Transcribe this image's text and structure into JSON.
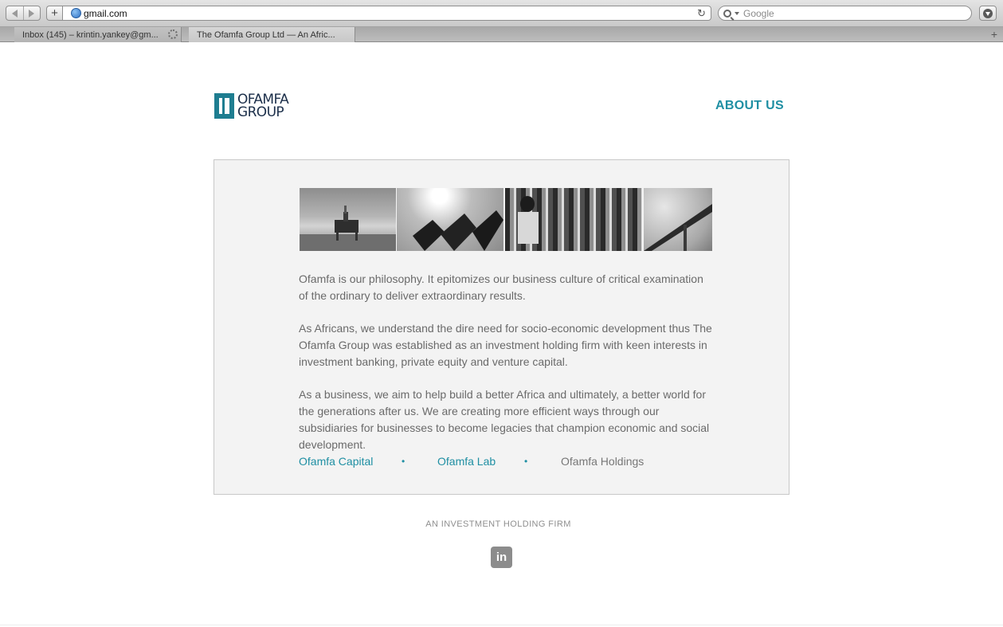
{
  "browser": {
    "url": "gmail.com",
    "search_placeholder": "Google",
    "add_label": "+",
    "reload_glyph": "↻",
    "tabs": [
      {
        "label": "Inbox (145) – krintin.yankey@gm..."
      },
      {
        "label": "The Ofamfa Group Ltd — An Afric..."
      }
    ],
    "new_tab_glyph": "+"
  },
  "header": {
    "logo_line1": "OFAMFA",
    "logo_line2": "GROUP",
    "nav_about": "ABOUT US"
  },
  "main": {
    "photos": [
      "oil-rig-photo",
      "solar-panels-photo",
      "market-vendor-photo",
      "highway-bridge-photo"
    ],
    "paragraphs": [
      "Ofamfa is our philosophy. It epitomizes our business culture of critical examination of the ordinary to deliver extraordinary results.",
      "As Africans, we understand the dire need for socio-economic development thus The Ofamfa Group was established as an investment holding firm with keen interests in investment banking, private equity and venture capital.",
      "As a business, we aim to help build a better Africa and ultimately, a better world for the generations after us. We are creating more efficient ways through our subsidiaries for businesses to become legacies that champion economic and social development."
    ],
    "subsidiaries": [
      "Ofamfa Capital",
      "Ofamfa Lab",
      "Ofamfa Holdings"
    ],
    "separator": "•"
  },
  "footer": {
    "tagline": "AN INVESTMENT HOLDING FIRM",
    "linkedin_label": "in"
  },
  "colors": {
    "accent": "#1f8fa3",
    "logo_navy": "#1c2f4a",
    "body_text": "#6a6a6a",
    "box_bg": "#f3f3f3"
  }
}
